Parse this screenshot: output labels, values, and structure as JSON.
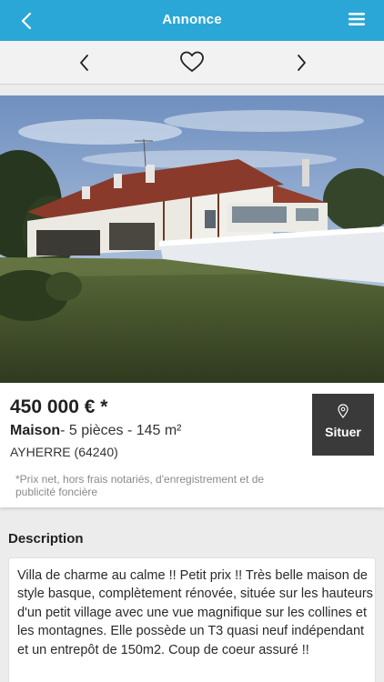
{
  "header": {
    "title": "Annonce",
    "back_icon": "chevron-left-icon",
    "menu_icon": "hamburger-menu-icon",
    "color": "#2aa7d6"
  },
  "navigation": {
    "prev_icon": "chevron-left-icon",
    "favorite_icon": "heart-outline-icon",
    "next_icon": "chevron-right-icon"
  },
  "listing": {
    "photo": "house-photo",
    "price": "450 000 € *",
    "type": "Maison",
    "details": "- 5 pièces - 145 m²",
    "location": "AYHERRE (64240)",
    "disclaimer": "*Prix net, hors frais notariés, d'enregistrement et de publicité foncière",
    "locate_label": "Situer",
    "locate_icon": "map-pin-icon"
  },
  "description": {
    "title": "Description",
    "text": "Villa de charme au calme !! Petit prix !! Très belle maison de style basque, complètement rénovée, située sur les hauteurs d'un petit village avec une vue magnifique sur les collines et les montagnes. Elle possède un T3 quasi neuf indépendant et un entrepôt de 150m2. Coup de coeur assuré !!"
  }
}
